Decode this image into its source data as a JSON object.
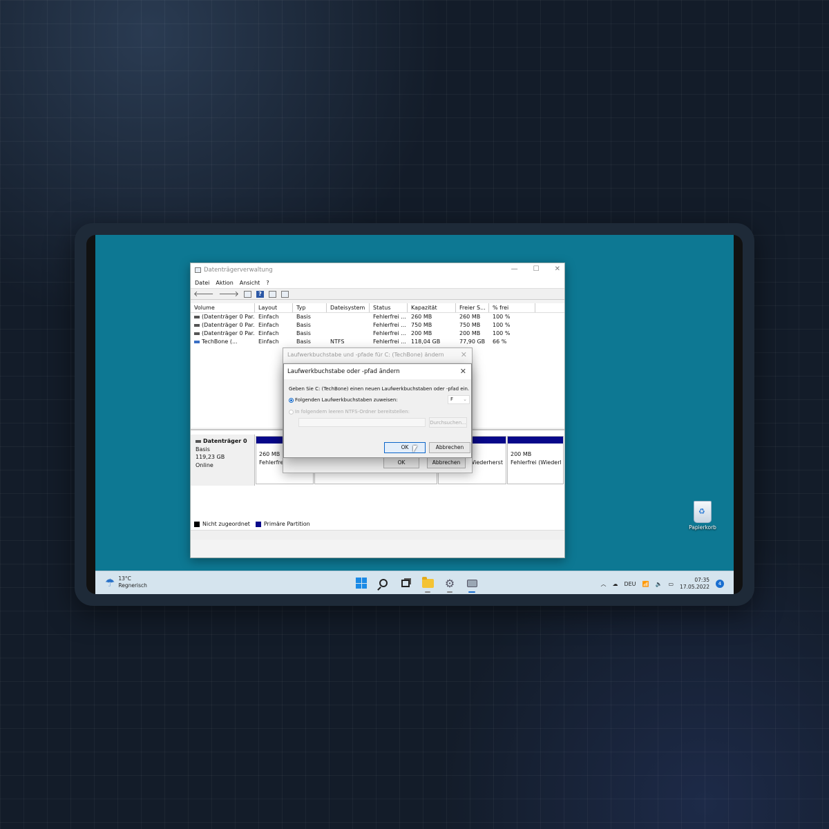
{
  "window": {
    "title": "Datenträgerverwaltung",
    "menu": [
      "Datei",
      "Aktion",
      "Ansicht",
      "?"
    ],
    "columns": [
      "Volume",
      "Layout",
      "Typ",
      "Dateisystem",
      "Status",
      "Kapazität",
      "Freier S...",
      "% frei"
    ],
    "rows": [
      [
        "(Datenträger 0 Par...",
        "Einfach",
        "Basis",
        "",
        "Fehlerfrei ...",
        "260 MB",
        "260 MB",
        "100 %"
      ],
      [
        "(Datenträger 0 Par...",
        "Einfach",
        "Basis",
        "",
        "Fehlerfrei ...",
        "750 MB",
        "750 MB",
        "100 %"
      ],
      [
        "(Datenträger 0 Par...",
        "Einfach",
        "Basis",
        "",
        "Fehlerfrei ...",
        "200 MB",
        "200 MB",
        "100 %"
      ],
      [
        "TechBone (...",
        "Einfach",
        "Basis",
        "NTFS",
        "Fehlerfrei ...",
        "118,04 GB",
        "77,90 GB",
        "66 %"
      ]
    ],
    "disk": {
      "name": "Datenträger 0",
      "type": "Basis",
      "size": "119,23 GB",
      "state": "Online"
    },
    "partitions": {
      "p1_size": "260 MB",
      "p1_status": "Fehlerfre",
      "p3_status": "Wiederherst",
      "p4_size": "200 MB",
      "p4_status": "Fehlerfrei (Wiederl"
    },
    "legend": [
      "Nicht zugeordnet",
      "Primäre Partition"
    ]
  },
  "dialog_back": {
    "title": "Laufwerkbuchstabe und -pfade für C: (TechBone) ändern",
    "ok": "OK",
    "cancel": "Abbrechen"
  },
  "dialog_front": {
    "title": "Laufwerkbuchstabe oder -pfad ändern",
    "instruction": "Geben Sie C: (TechBone) einen neuen Laufwerkbuchstaben oder -pfad ein.",
    "option_assign": "Folgenden Laufwerkbuchstaben zuweisen:",
    "selected_letter": "F",
    "option_mount": "In folgendem leeren NTFS-Ordner bereitstellen:",
    "browse": "Durchsuchen...",
    "ok": "OK",
    "cancel": "Abbrechen"
  },
  "desktop": {
    "recycle_bin": "Papierkorb"
  },
  "taskbar": {
    "weather_temp": "13°C",
    "weather_desc": "Regnerisch",
    "language": "DEU",
    "time": "07:35",
    "date": "17.05.2022",
    "notifications": "4"
  },
  "colors": {
    "desktop": "#0d7893",
    "primary_partition": "#08088a",
    "unallocated": "#000000"
  }
}
